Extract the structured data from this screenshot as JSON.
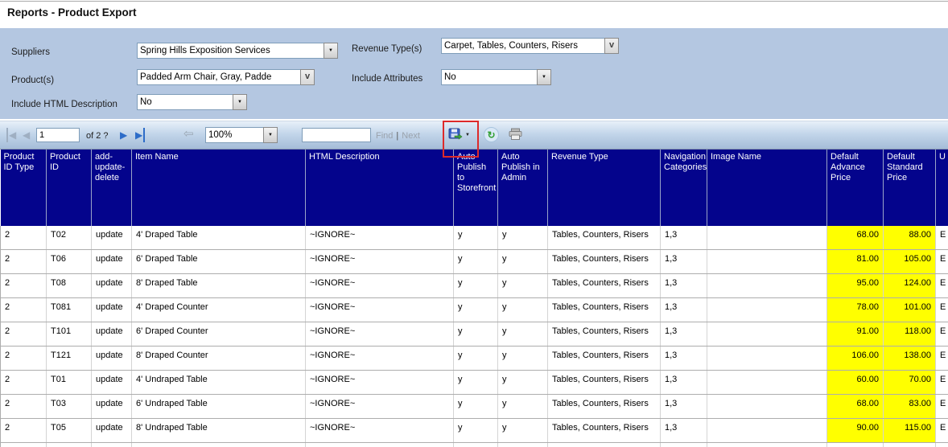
{
  "page": {
    "title": "Reports - Product Export"
  },
  "filters": {
    "suppliers": {
      "label": "Suppliers",
      "value": "Spring Hills Exposition Services"
    },
    "revenue_types": {
      "label": "Revenue Type(s)",
      "value": "Carpet, Tables, Counters, Risers"
    },
    "products": {
      "label": "Product(s)",
      "value": "Padded Arm Chair, Gray, Padde"
    },
    "include_attributes": {
      "label": "Include Attributes",
      "value": "No"
    },
    "include_html_description": {
      "label": "Include HTML Description",
      "value": "No"
    }
  },
  "toolbar": {
    "page_input": "1",
    "pages_label": "of 2 ?",
    "zoom_value": "100%",
    "find_input_value": "",
    "find_label": "Find",
    "separator": "|",
    "next_label": "Next",
    "icon_glyphs": {
      "first_page": "◀",
      "previous_page": "◀",
      "next_page": "▶",
      "last_page": "▶",
      "back_to_parent": "⇦",
      "dropdown_arrow": "▼",
      "export_caret": "▼",
      "refresh": "↻",
      "multiselect_chevron": "v"
    }
  },
  "table": {
    "columns": [
      {
        "label": "Product ID Type",
        "highlight": false,
        "align": "left"
      },
      {
        "label": "Product ID",
        "highlight": false,
        "align": "left"
      },
      {
        "label": "add-update-delete",
        "highlight": false,
        "align": "left"
      },
      {
        "label": "Item Name",
        "highlight": false,
        "align": "left"
      },
      {
        "label": "HTML Description",
        "highlight": false,
        "align": "left"
      },
      {
        "label": "Auto Publish to Storefront",
        "highlight": false,
        "align": "left"
      },
      {
        "label": "Auto Publish in Admin",
        "highlight": false,
        "align": "left"
      },
      {
        "label": "Revenue Type",
        "highlight": false,
        "align": "left"
      },
      {
        "label": "Navigation Categories",
        "highlight": false,
        "align": "left"
      },
      {
        "label": "Image Name",
        "highlight": false,
        "align": "left"
      },
      {
        "label": "Default Advance Price",
        "highlight": true,
        "align": "right"
      },
      {
        "label": "Default Standard Price",
        "highlight": true,
        "align": "right"
      },
      {
        "label": "U",
        "highlight": false,
        "align": "left"
      }
    ],
    "rows": [
      [
        "2",
        "T02",
        "update",
        "4' Draped Table",
        "~IGNORE~",
        "y",
        "y",
        "Tables, Counters, Risers",
        "1,3",
        "",
        "68.00",
        "88.00",
        "E"
      ],
      [
        "2",
        "T06",
        "update",
        "6' Draped Table",
        "~IGNORE~",
        "y",
        "y",
        "Tables, Counters, Risers",
        "1,3",
        "",
        "81.00",
        "105.00",
        "E"
      ],
      [
        "2",
        "T08",
        "update",
        "8' Draped Table",
        "~IGNORE~",
        "y",
        "y",
        "Tables, Counters, Risers",
        "1,3",
        "",
        "95.00",
        "124.00",
        "E"
      ],
      [
        "2",
        "T081",
        "update",
        "4' Draped Counter",
        "~IGNORE~",
        "y",
        "y",
        "Tables, Counters, Risers",
        "1,3",
        "",
        "78.00",
        "101.00",
        "E"
      ],
      [
        "2",
        "T101",
        "update",
        "6' Draped Counter",
        "~IGNORE~",
        "y",
        "y",
        "Tables, Counters, Risers",
        "1,3",
        "",
        "91.00",
        "118.00",
        "E"
      ],
      [
        "2",
        "T121",
        "update",
        "8' Draped Counter",
        "~IGNORE~",
        "y",
        "y",
        "Tables, Counters, Risers",
        "1,3",
        "",
        "106.00",
        "138.00",
        "E"
      ],
      [
        "2",
        "T01",
        "update",
        "4' Undraped Table",
        "~IGNORE~",
        "y",
        "y",
        "Tables, Counters, Risers",
        "1,3",
        "",
        "60.00",
        "70.00",
        "E"
      ],
      [
        "2",
        "T03",
        "update",
        "6' Undraped Table",
        "~IGNORE~",
        "y",
        "y",
        "Tables, Counters, Risers",
        "1,3",
        "",
        "68.00",
        "83.00",
        "E"
      ],
      [
        "2",
        "T05",
        "update",
        "8' Undraped Table",
        "~IGNORE~",
        "y",
        "y",
        "Tables, Counters, Risers",
        "1,3",
        "",
        "90.00",
        "115.00",
        "E"
      ]
    ]
  },
  "colors": {
    "panel_bg": "#b4c7e1",
    "header_bg": "#04048c",
    "highlight_yellow": "#ffff00",
    "annotation_red": "#dd2a2a",
    "enabled_nav": "#2d6cc8",
    "disabled_nav": "#9fafc2"
  }
}
